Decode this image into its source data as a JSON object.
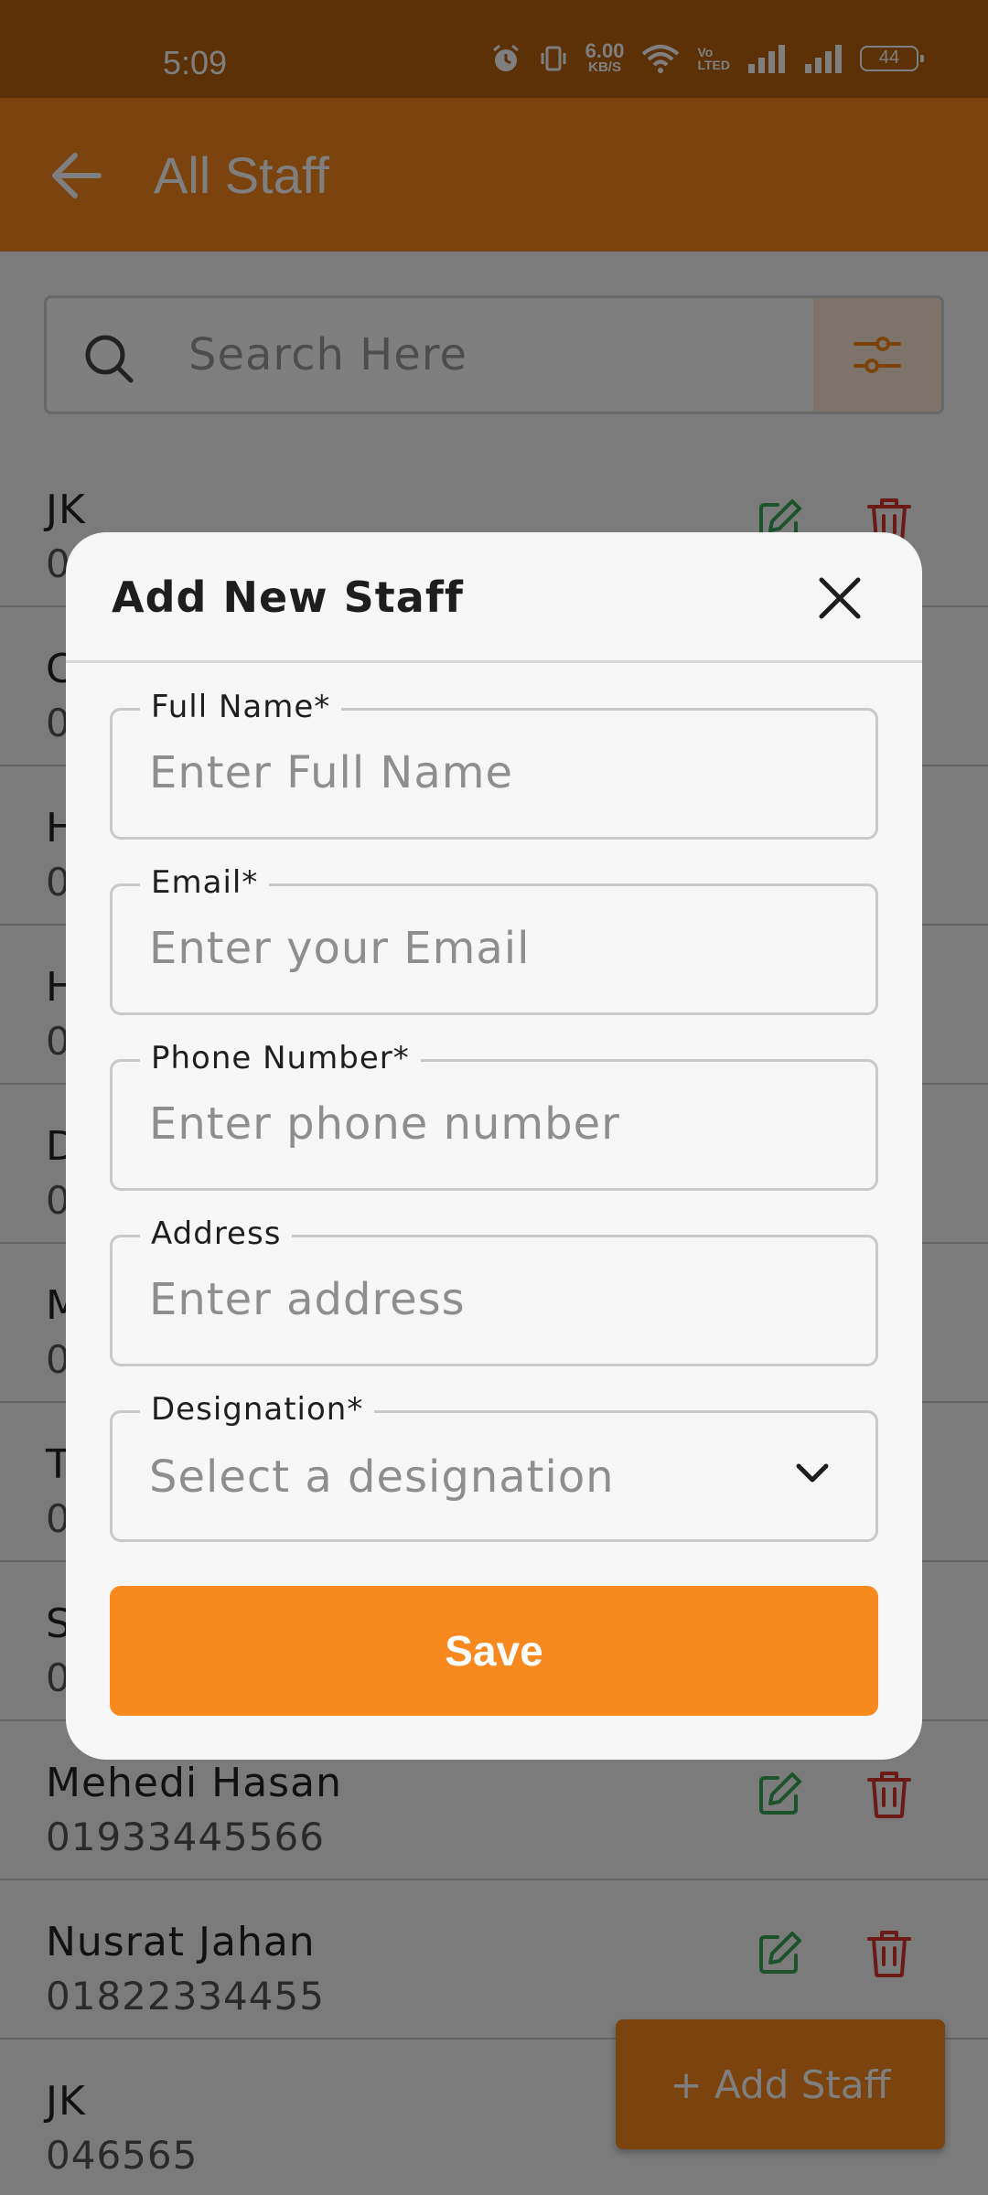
{
  "status_bar": {
    "time": "5:09",
    "net_speed": "6.00",
    "net_unit": "KB/S",
    "volte_top": "Vo",
    "volte_bottom": "LTED",
    "battery": "44"
  },
  "app_bar": {
    "title": "All Staff",
    "back_icon": "arrow-left-icon"
  },
  "search": {
    "placeholder": "Search Here",
    "icon": "search-icon",
    "filter_icon": "sliders-icon"
  },
  "staff_list": [
    {
      "name": "JK",
      "phone": "0"
    },
    {
      "name": "C",
      "phone": "0"
    },
    {
      "name": "H",
      "phone": "0"
    },
    {
      "name": "H",
      "phone": "0"
    },
    {
      "name": "D",
      "phone": "0"
    },
    {
      "name": "M",
      "phone": "0"
    },
    {
      "name": "T",
      "phone": "0"
    },
    {
      "name": "S",
      "phone": "0"
    },
    {
      "name": "Mehedi Hasan",
      "phone": "01933445566"
    },
    {
      "name": "Nusrat Jahan",
      "phone": "01822334455"
    },
    {
      "name": "JK",
      "phone": "046565"
    }
  ],
  "fab": {
    "label": "+ Add Staff"
  },
  "dialog": {
    "title": "Add New Staff",
    "close_icon": "close-icon",
    "fields": {
      "full_name": {
        "label": "Full Name*",
        "placeholder": "Enter Full Name",
        "value": ""
      },
      "email": {
        "label": "Email*",
        "placeholder": "Enter your Email",
        "value": ""
      },
      "phone": {
        "label": "Phone Number*",
        "placeholder": "Enter phone number",
        "value": ""
      },
      "address": {
        "label": "Address",
        "placeholder": "Enter address",
        "value": ""
      },
      "designation": {
        "label": "Designation*",
        "selected": "Select a designation"
      }
    },
    "save_label": "Save"
  },
  "colors": {
    "primary": "#f7891f",
    "status_bar": "#b8620f",
    "edit_icon": "#3aa55b",
    "delete_icon": "#d9342b"
  }
}
